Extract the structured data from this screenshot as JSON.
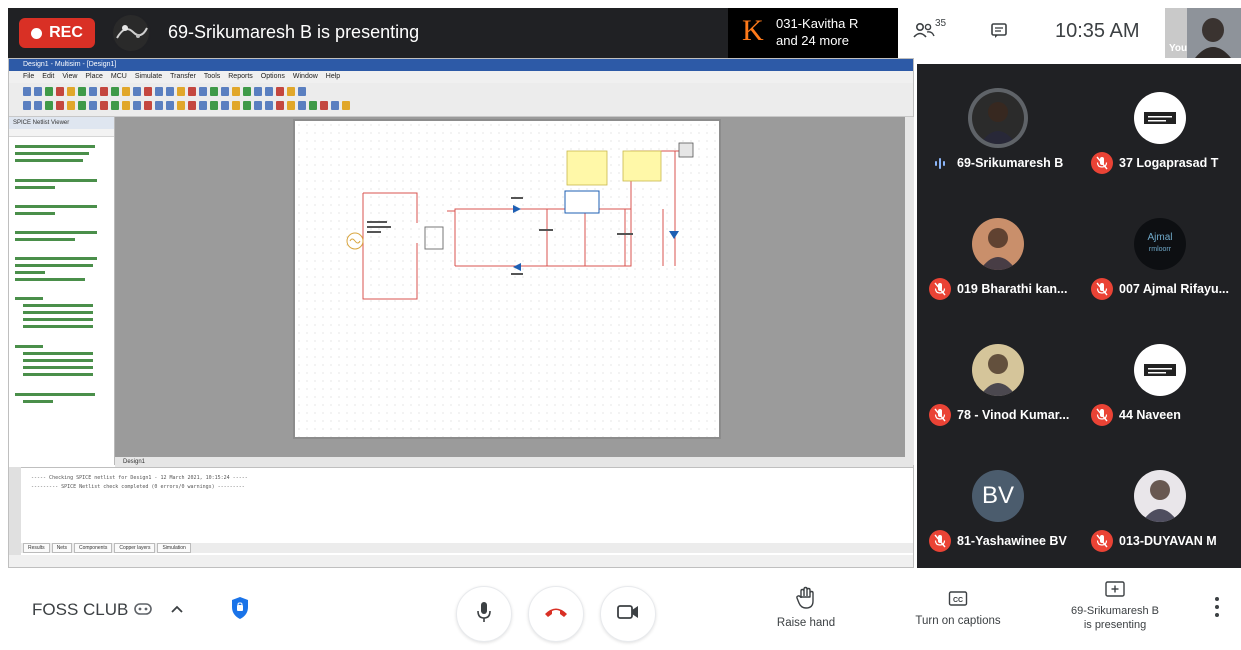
{
  "recording": {
    "label": "REC"
  },
  "presenter_banner": {
    "title": "69-Srikumaresh B is presenting"
  },
  "latest_joined": {
    "initial": "K",
    "line1": "031-Kavitha R",
    "line2": "and 24 more"
  },
  "header": {
    "participant_count": "35",
    "time": "10:35 AM",
    "self_label": "You"
  },
  "shared_screen": {
    "window_title": "Design1 - Multisim - [Design1]",
    "menu_items": [
      "File",
      "Edit",
      "View",
      "Place",
      "MCU",
      "Simulate",
      "Transfer",
      "Tools",
      "Reports",
      "Options",
      "Window",
      "Help"
    ],
    "netlist_title": "SPICE Netlist Viewer",
    "doc_tab": "Design1",
    "output_lines": [
      "----- Checking SPICE netlist for Design1 - 12 March 2021, 10:15:24 -----",
      "--------- SPICE Netlist check completed (0 errors/0 warnings) ---------"
    ],
    "output_tabs": [
      "Results",
      "Nets",
      "Components",
      "Copper layers",
      "Simulation"
    ]
  },
  "participants": [
    {
      "name": "69-Srikumaresh B",
      "muted": false,
      "avatar": "photo",
      "bg": "#2b2b2b"
    },
    {
      "name": "37 Logaprasad T",
      "muted": true,
      "avatar": "logo",
      "bg": "#ffffff"
    },
    {
      "name": "019 Bharathi kan...",
      "muted": true,
      "avatar": "photo",
      "bg": "#c98f6b"
    },
    {
      "name": "007 Ajmal Rifayu...",
      "muted": true,
      "avatar": "text",
      "text": "Ajmal",
      "subtext": "rmloorr",
      "bg": "#0d0f12"
    },
    {
      "name": "78 - Vinod Kumar...",
      "muted": true,
      "avatar": "photo",
      "bg": "#d5c59a"
    },
    {
      "name": "44 Naveen",
      "muted": true,
      "avatar": "logo",
      "bg": "#ffffff"
    },
    {
      "name": "81-Yashawinee BV",
      "muted": true,
      "avatar": "initials",
      "text": "BV",
      "bg": "#4b5c6d"
    },
    {
      "name": "013-DUYAVAN M",
      "muted": true,
      "avatar": "photo",
      "bg": "#e9e6ea"
    }
  ],
  "footer": {
    "meeting_name": "FOSS CLUB",
    "raise_hand_label": "Raise hand",
    "captions_label": "Turn on captions",
    "presenting_line1": "69-Srikumaresh B",
    "presenting_line2": "is presenting"
  },
  "colors": {
    "mute_red": "#ea4335",
    "end_call_red": "#d93025",
    "rec_red": "#d93025",
    "tile_bg": "#202124",
    "shield_blue": "#1a73e8"
  }
}
